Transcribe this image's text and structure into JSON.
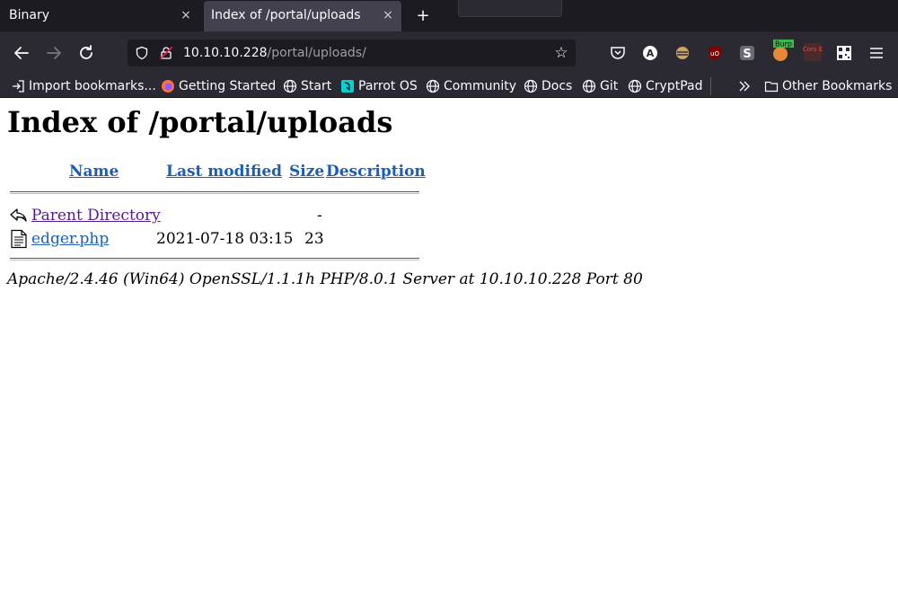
{
  "browser": {
    "tabs": [
      {
        "title": "Binary",
        "close": "×",
        "active": false
      },
      {
        "title": "Index of /portal/uploads",
        "close": "×",
        "active": true
      }
    ],
    "new_tab": "+",
    "url": {
      "host": "10.10.10.228",
      "path": "/portal/uploads/"
    },
    "bookmarks": [
      {
        "label": "Import bookmarks...",
        "icon": "import-icon"
      },
      {
        "label": "Getting Started",
        "icon": "firefox-icon"
      },
      {
        "label": "Start",
        "icon": "globe-icon"
      },
      {
        "label": "Parrot OS",
        "icon": "parrot-icon"
      },
      {
        "label": "Community",
        "icon": "globe-icon"
      },
      {
        "label": "Docs",
        "icon": "globe-icon"
      },
      {
        "label": "Git",
        "icon": "globe-icon"
      },
      {
        "label": "CryptPad",
        "icon": "globe-icon"
      }
    ],
    "other_bookmarks": "Other Bookmarks",
    "extensions": [
      "pocket-icon",
      "account-icon",
      "extension-icon",
      "ublock-icon",
      "s-extension-icon",
      "burp-icon",
      "cors-icon",
      "qr-icon",
      "menu-icon"
    ],
    "burp_label": "Burp",
    "cors_label": "Cors E"
  },
  "page": {
    "title": "Index of /portal/uploads",
    "columns": [
      "Name",
      "Last modified",
      "Size",
      "Description"
    ],
    "rows": [
      {
        "name": "Parent Directory",
        "modified": "",
        "size": "-",
        "description": "",
        "icon": "back-icon"
      },
      {
        "name": "edger.php",
        "modified": "2021-07-18 03:15",
        "size": "23",
        "description": "",
        "icon": "file-icon"
      }
    ],
    "address": "Apache/2.4.46 (Win64) OpenSSL/1.1.1h PHP/8.0.1 Server at 10.10.10.228 Port 80"
  },
  "colors": {
    "chrome_dark": "#1c1b22",
    "toolbar": "#2b2a33",
    "link": "#1a5fb4",
    "visited": "#551a8b"
  }
}
